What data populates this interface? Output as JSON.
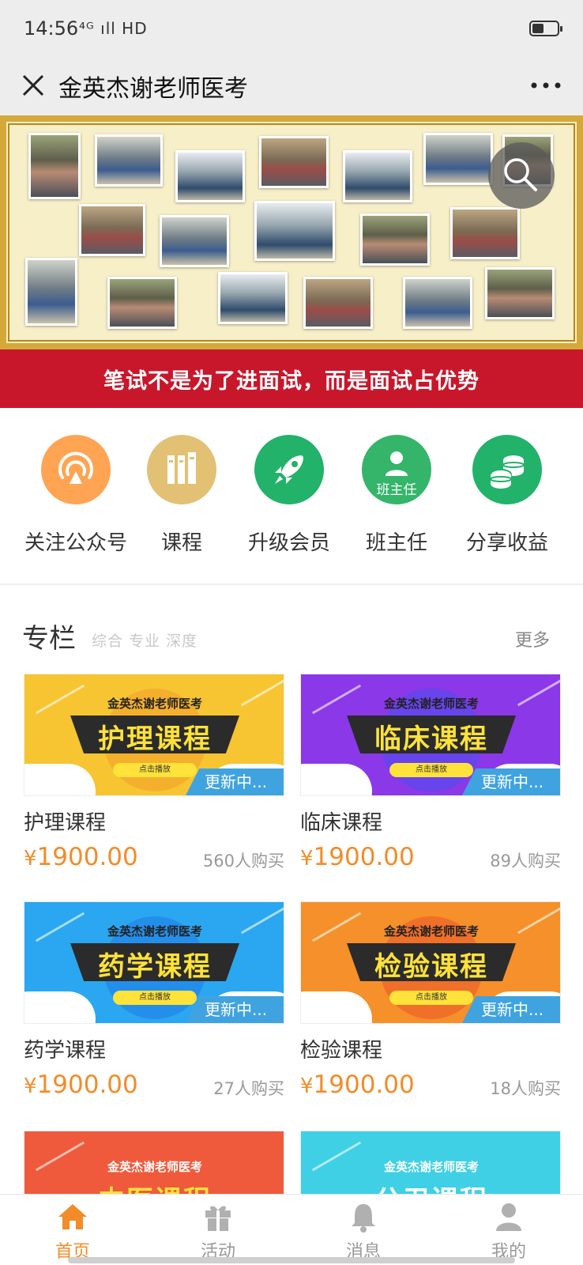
{
  "status_bar": {
    "time": "14:56",
    "signal": "⁴ᴳ ıll HD"
  },
  "title_bar": {
    "title": "金英杰谢老师医考"
  },
  "banner": {
    "slogan": "笔试不是为了进面试，而是面试占优势"
  },
  "quick_nav": [
    {
      "label": "关注公众号",
      "icon": "antenna-icon",
      "color": "#ffa452"
    },
    {
      "label": "课程",
      "icon": "books-icon",
      "color": "#e2c174"
    },
    {
      "label": "升级会员",
      "icon": "rocket-icon",
      "color": "#22b26a"
    },
    {
      "label": "班主任",
      "icon": "teacher-icon",
      "color": "#35b56a",
      "badge": "班主任"
    },
    {
      "label": "分享收益",
      "icon": "coins-icon",
      "color": "#22b26a"
    }
  ],
  "section": {
    "title": "专栏",
    "subtitle": "综合 专业 深度",
    "more": "更多"
  },
  "courses": [
    {
      "brand": "金英杰谢老师医考",
      "cover_title": "护理课程",
      "play": "点击播放",
      "updating": "更新中...",
      "name": "护理课程",
      "currency": "¥",
      "price": "1900.00",
      "buyers": "560人购买",
      "bg": "#f7c531"
    },
    {
      "brand": "金英杰谢老师医考",
      "cover_title": "临床课程",
      "play": "点击播放",
      "updating": "更新中...",
      "name": "临床课程",
      "currency": "¥",
      "price": "1900.00",
      "buyers": "89人购买",
      "bg": "#8a38e8"
    },
    {
      "brand": "金英杰谢老师医考",
      "cover_title": "药学课程",
      "play": "点击播放",
      "updating": "更新中...",
      "name": "药学课程",
      "currency": "¥",
      "price": "1900.00",
      "buyers": "27人购买",
      "bg": "#2aa7f0"
    },
    {
      "brand": "金英杰谢老师医考",
      "cover_title": "检验课程",
      "play": "点击播放",
      "updating": "更新中...",
      "name": "检验课程",
      "currency": "¥",
      "price": "1900.00",
      "buyers": "18人购买",
      "bg": "#f5902a"
    }
  ],
  "partial_courses": [
    {
      "brand": "金英杰谢老师医考",
      "cover_title": "中医课程"
    },
    {
      "brand": "金英杰谢老师医考",
      "cover_title": "公卫课程"
    }
  ],
  "tabs": [
    {
      "label": "首页",
      "icon": "home-icon",
      "active": true
    },
    {
      "label": "活动",
      "icon": "gift-icon",
      "active": false
    },
    {
      "label": "消息",
      "icon": "bell-icon",
      "active": false
    },
    {
      "label": "我的",
      "icon": "user-icon",
      "active": false
    }
  ],
  "colors": {
    "accent": "#f28c28",
    "slogan_band": "#c8172b",
    "banner_frame": "#d4a93a"
  }
}
